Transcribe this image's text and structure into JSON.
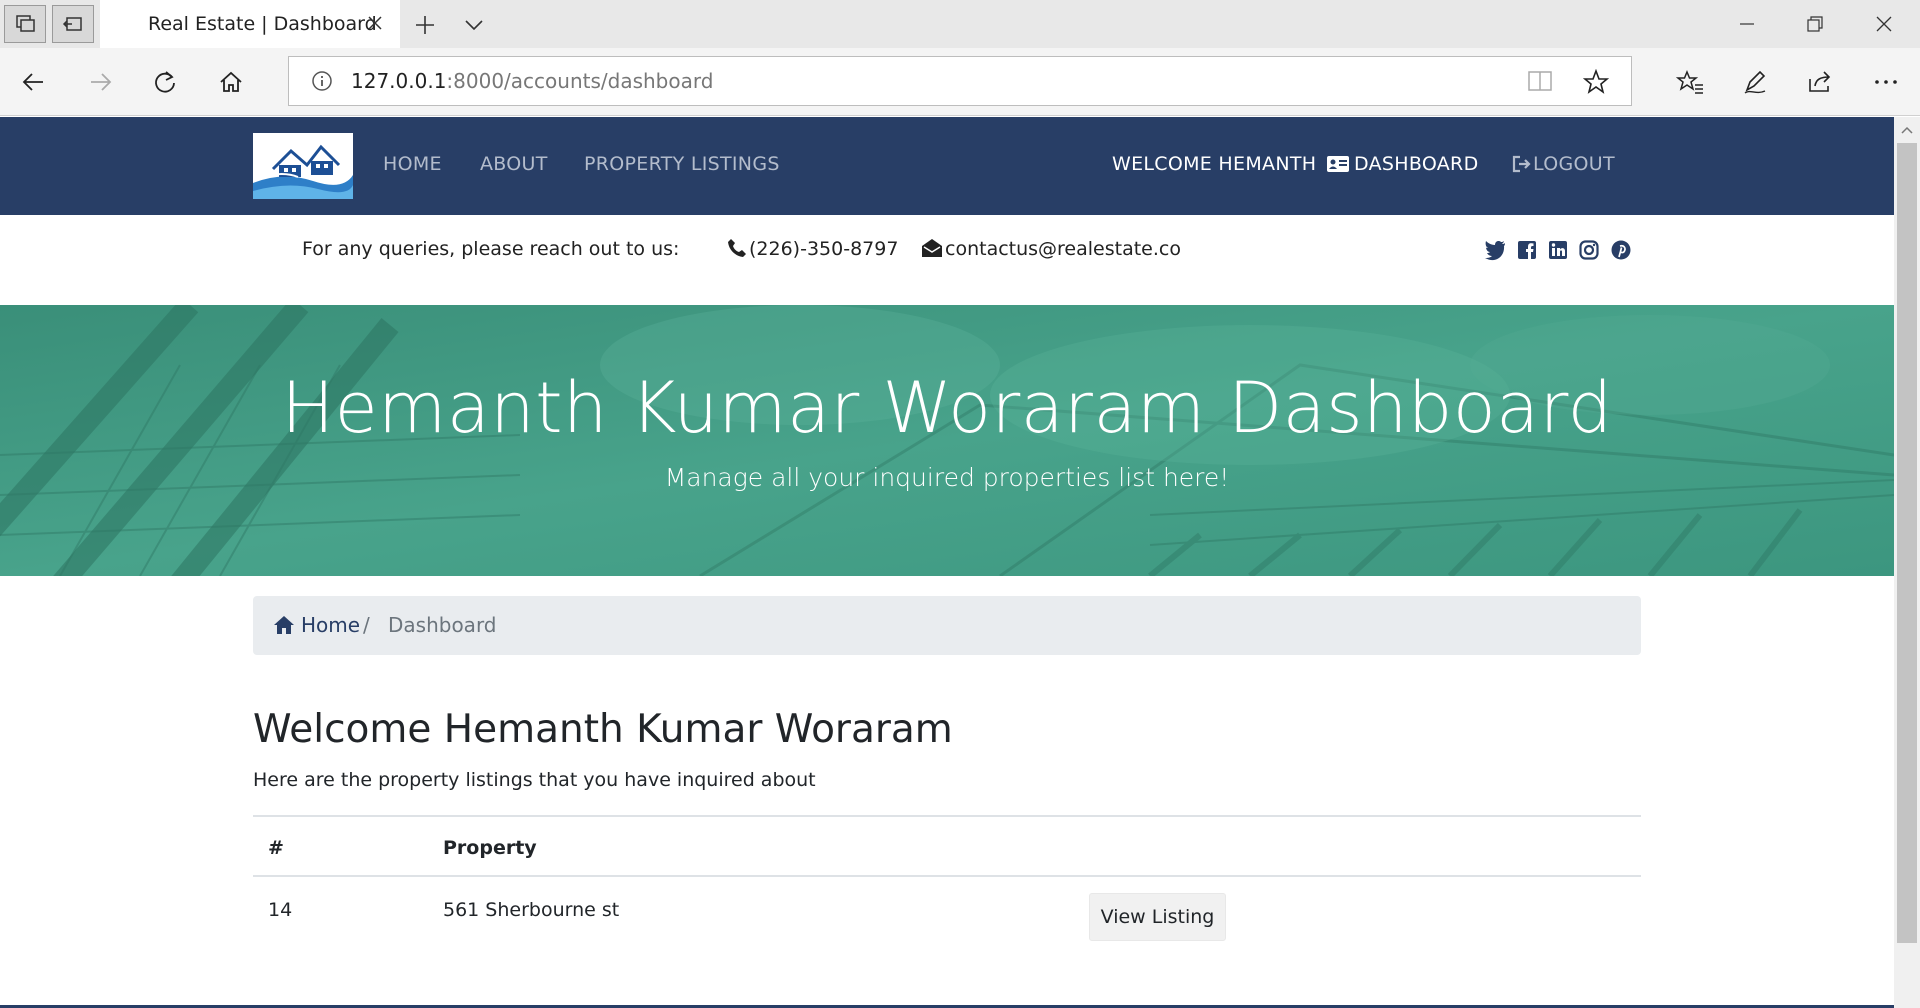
{
  "browser": {
    "tab_title": "Real Estate | Dashboard",
    "url_host": "127.0.0.1",
    "url_path": ":8000/accounts/dashboard"
  },
  "nav": {
    "home": "HOME",
    "about": "ABOUT",
    "listings": "PROPERTY LISTINGS",
    "welcome": "WELCOME HEMANTH",
    "dashboard": "DASHBOARD",
    "logout": "LOGOUT"
  },
  "contact": {
    "prompt": "For any queries, please reach out to us:",
    "phone": "(226)-350-8797",
    "email": "contactus@realestate.co"
  },
  "hero": {
    "title": "Hemanth Kumar Woraram Dashboard",
    "subtitle": "Manage all your inquired properties list here!"
  },
  "breadcrumb": {
    "home": "Home",
    "separator": "/",
    "current": "Dashboard"
  },
  "main": {
    "heading": "Welcome Hemanth Kumar Woraram",
    "subheading": "Here are the property listings that you have inquired about"
  },
  "table": {
    "headers": [
      "#",
      "Property"
    ],
    "rows": [
      {
        "id": "14",
        "property": "561 Sherbourne st",
        "action": "View Listing"
      }
    ]
  },
  "colors": {
    "navbar": "#283e66",
    "hero": "#3f9b84",
    "breadcrumb_bg": "#e9ecef"
  },
  "icons": [
    "tab-actions-icon",
    "tab-aside-icon",
    "close-icon",
    "new-tab-icon",
    "tab-list-icon",
    "minimize-icon",
    "restore-icon",
    "window-close-icon",
    "back-icon",
    "forward-icon",
    "refresh-icon",
    "home-icon",
    "info-icon",
    "reading-view-icon",
    "favorite-star-icon",
    "favorites-icon",
    "pen-icon",
    "share-icon",
    "more-icon",
    "id-card-icon",
    "sign-out-icon",
    "phone-icon",
    "envelope-icon",
    "twitter-icon",
    "facebook-icon",
    "linkedin-icon",
    "instagram-icon",
    "pinterest-icon"
  ]
}
